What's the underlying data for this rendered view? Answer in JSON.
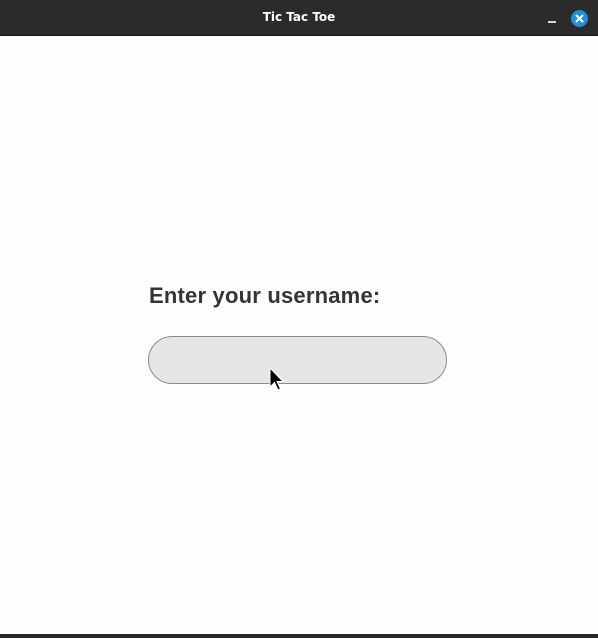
{
  "window": {
    "title": "Tic Tac Toe"
  },
  "prompt": {
    "label": "Enter your username:"
  },
  "username_input": {
    "value": "",
    "placeholder": ""
  },
  "icons": {
    "minimize": "minimize-icon",
    "close": "close-icon",
    "pointer": "mouse-pointer-icon"
  },
  "colors": {
    "titlebar": "#2b2b2b",
    "close_button": "#1f8fd6",
    "input_background": "#e6e6e6",
    "label_text": "#353535"
  }
}
